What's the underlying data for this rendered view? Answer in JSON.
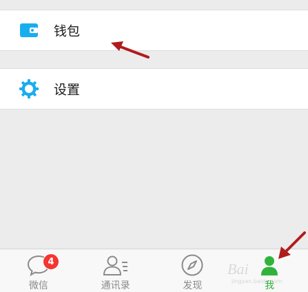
{
  "menu": {
    "wallet": {
      "label": "钱包",
      "icon": "wallet-icon"
    },
    "settings": {
      "label": "设置",
      "icon": "settings-gear-icon"
    }
  },
  "tabbar": {
    "tabs": [
      {
        "label": "微信",
        "icon": "chat-bubble-icon",
        "badge": "4",
        "active": false
      },
      {
        "label": "通讯录",
        "icon": "contacts-icon",
        "active": false
      },
      {
        "label": "发现",
        "icon": "compass-icon",
        "active": false
      },
      {
        "label": "我",
        "icon": "person-icon",
        "active": true
      }
    ]
  },
  "watermark": {
    "text": "Bai",
    "subtext": "jingyan.baidu.com"
  },
  "colors": {
    "accent_green": "#31b33b",
    "icon_blue": "#1aadee",
    "badge_red": "#f43530",
    "annotation_arrow": "#b01c1c"
  }
}
